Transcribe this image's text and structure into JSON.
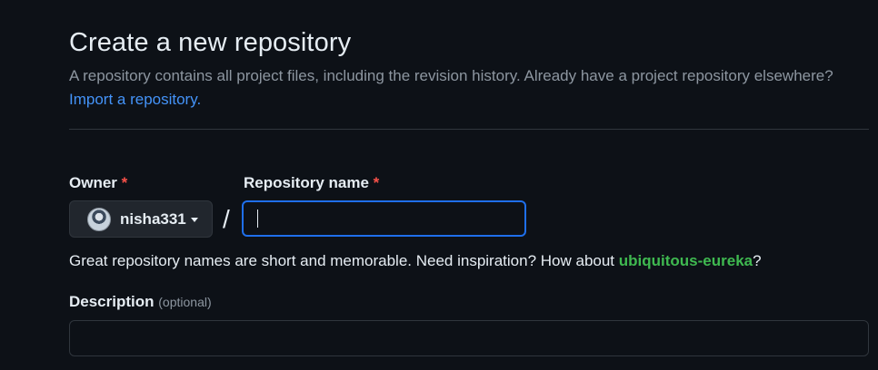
{
  "header": {
    "title": "Create a new repository",
    "subtitle": "A repository contains all project files, including the revision history. Already have a project repository elsewhere?",
    "import_link": "Import a repository."
  },
  "owner": {
    "label": "Owner",
    "required_marker": "*",
    "selected": "nisha331",
    "avatar_icon": "user-avatar"
  },
  "separator": "/",
  "repository_name": {
    "label": "Repository name",
    "required_marker": "*",
    "value": "",
    "placeholder": ""
  },
  "hint": {
    "prefix": "Great repository names are short and memorable. Need inspiration? How about ",
    "suggestion": "ubiquitous-eureka",
    "suffix": "?"
  },
  "description": {
    "label": "Description",
    "optional_text": "(optional)",
    "value": "",
    "placeholder": ""
  },
  "colors": {
    "background": "#0d1117",
    "link": "#4493f8",
    "required": "#f85149",
    "suggestion": "#3fb950",
    "focus_border": "#1f6feb"
  }
}
